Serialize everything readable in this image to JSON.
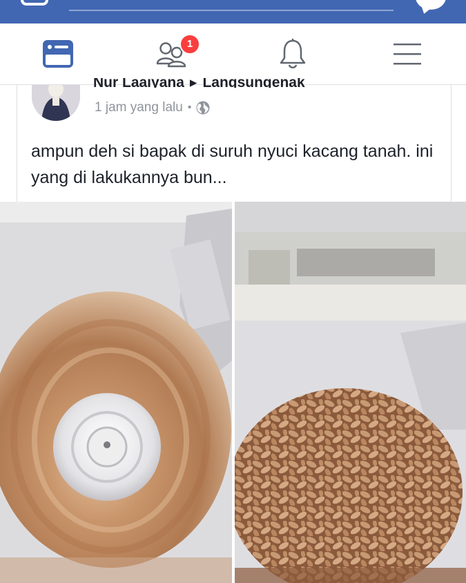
{
  "nav": {
    "friend_requests_count": "1",
    "icons": [
      "news-feed-icon",
      "friend-requests-icon",
      "notifications-icon",
      "menu-icon"
    ]
  },
  "post": {
    "author_name": "Nur Laaiyana",
    "author_separator": "▸",
    "group_name": "Langsungenak",
    "timestamp": "1 jam yang lalu",
    "timestamp_separator": "•",
    "text": "ampun deh si bapak di suruh nyuci kacang tanah. ini yang di lakukannya bun..."
  },
  "colors": {
    "brand_blue": "#4267b2",
    "badge_red": "#fa3e3e",
    "meta_gray": "#90949c",
    "text_dark": "#1d2129"
  }
}
